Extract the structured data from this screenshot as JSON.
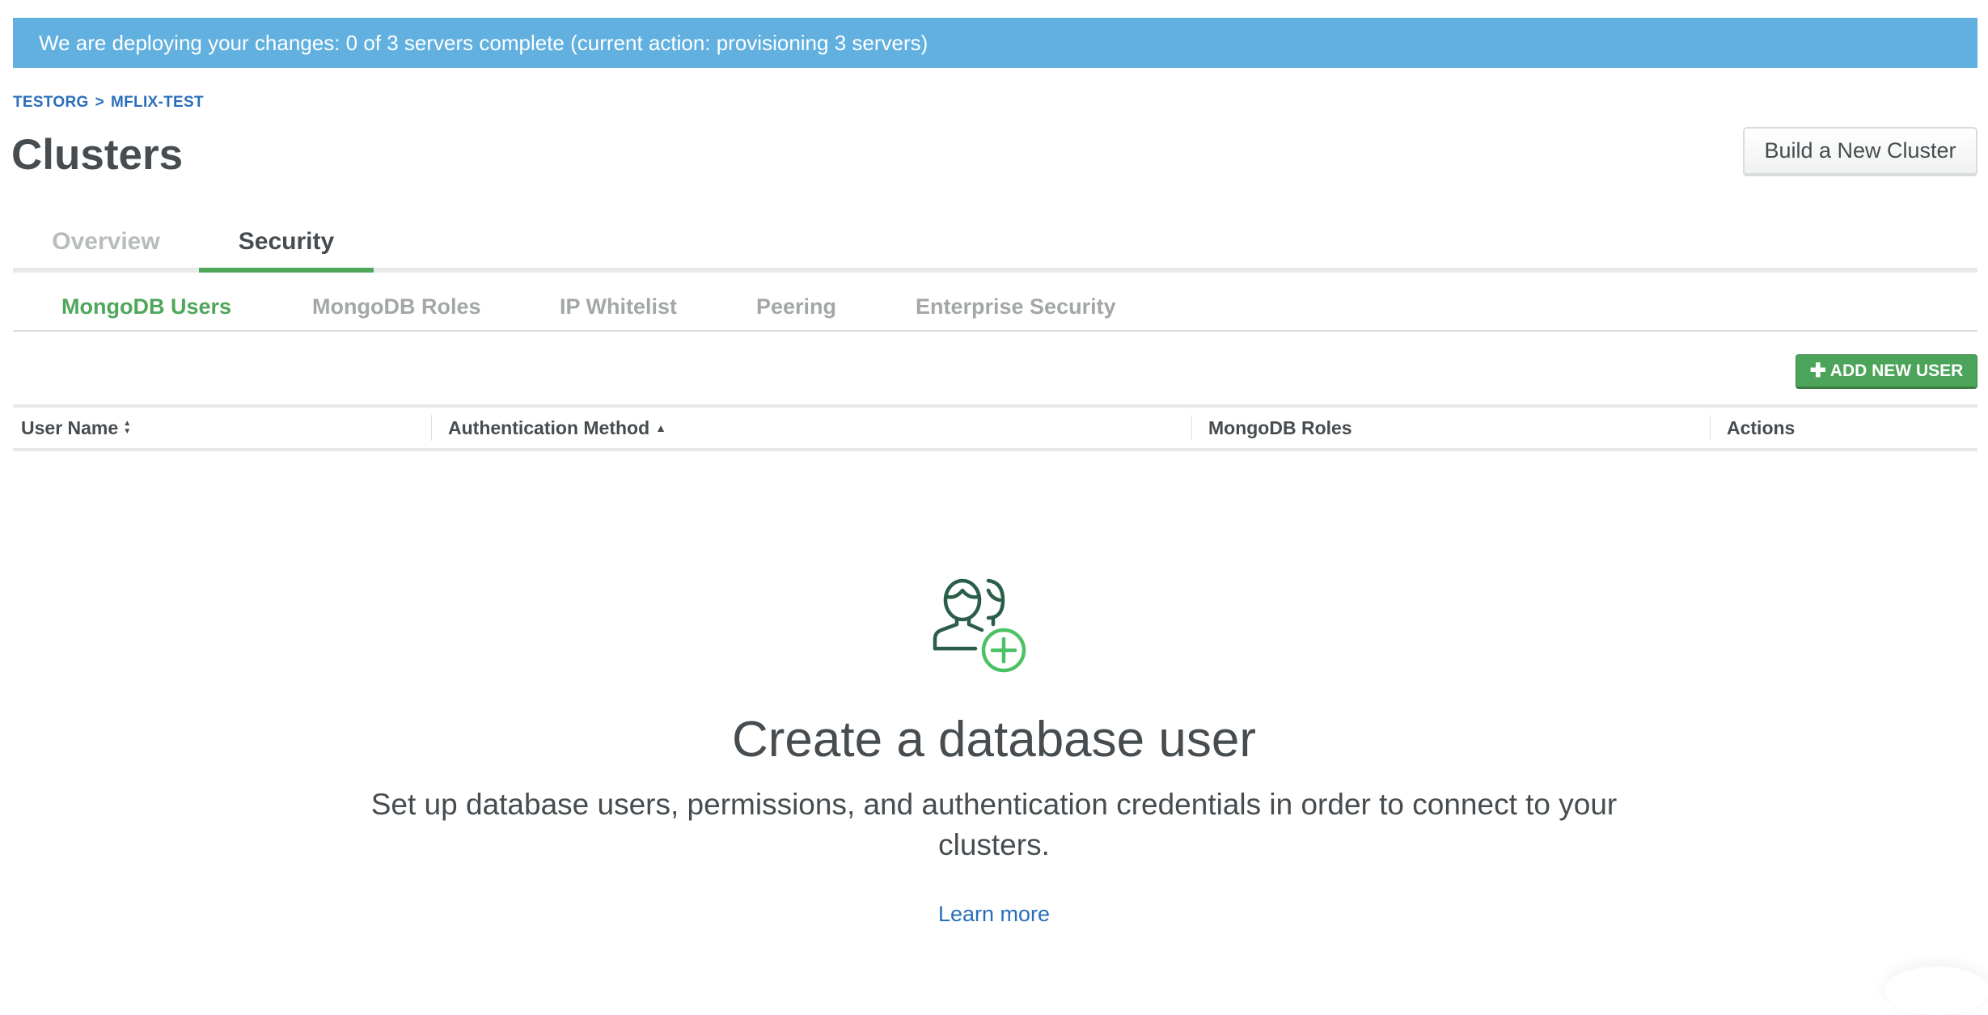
{
  "banner": {
    "text": "We are deploying your changes: 0 of 3 servers complete (current action: provisioning 3 servers)",
    "color": "#61b0df"
  },
  "breadcrumb": {
    "items": [
      "TESTORG",
      "MFLIX-TEST"
    ],
    "separator": ">"
  },
  "header": {
    "title": "Clusters",
    "build_button_label": "Build a New Cluster"
  },
  "tabs": [
    {
      "label": "Overview",
      "active": false
    },
    {
      "label": "Security",
      "active": true
    }
  ],
  "subtabs": [
    {
      "label": "MongoDB Users",
      "active": true
    },
    {
      "label": "MongoDB Roles",
      "active": false
    },
    {
      "label": "IP Whitelist",
      "active": false
    },
    {
      "label": "Peering",
      "active": false
    },
    {
      "label": "Enterprise Security",
      "active": false
    }
  ],
  "toolbar": {
    "add_user_label": "ADD NEW USER",
    "add_user_icon": "plus-icon"
  },
  "table": {
    "columns": [
      {
        "label": "User Name",
        "sort": "sortable",
        "sort_icon": "sort-both-icon"
      },
      {
        "label": "Authentication Method",
        "sort": "ascending",
        "sort_icon": "sort-asc-icon"
      },
      {
        "label": "MongoDB Roles",
        "sort": "none"
      },
      {
        "label": "Actions",
        "sort": "none"
      }
    ],
    "rows": []
  },
  "empty_state": {
    "icon": "add-user-icon",
    "title": "Create a database user",
    "description": "Set up database users, permissions, and authentication credentials in order to connect to your clusters.",
    "link_label": "Learn more"
  },
  "colors": {
    "accent_green": "#4fa75b",
    "link_blue": "#2a6ebb",
    "text_dark": "#464c4f",
    "icon_dark_green": "#2a5e48",
    "icon_light_green": "#4dc165"
  }
}
